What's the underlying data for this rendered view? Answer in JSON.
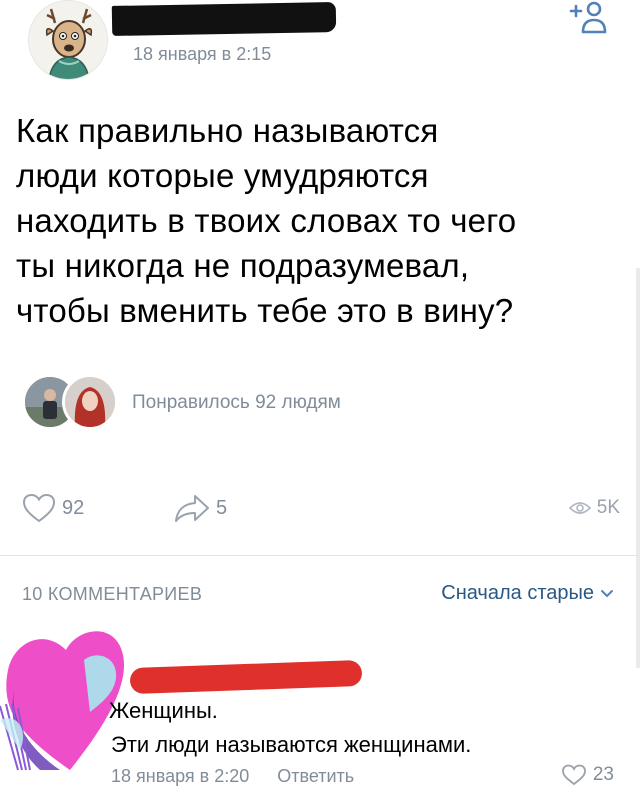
{
  "post": {
    "date": "18 января в 2:15",
    "text_lines": [
      "Как правильно называются",
      "люди которые умудряются",
      "находить в твоих словах то чего",
      "ты никогда не подразумевал,",
      "чтобы вменить тебе это в вину?"
    ],
    "likes_summary": "Понравилось 92 людям",
    "likes_count": "92",
    "shares_count": "5",
    "views_count": "5K"
  },
  "comments": {
    "count_label": "10 КОММЕНТАРИЕВ",
    "sort_label": "Сначала старые",
    "first": {
      "line1": "Женщины.",
      "line2": "Эти люди называются женщинами.",
      "date": "18 января в 2:20",
      "reply_label": "Ответить",
      "likes": "23"
    }
  },
  "colors": {
    "secondary_text": "#818c99",
    "link": "#2a5885",
    "redaction_black": "#111111",
    "redaction_red": "#e0302b"
  },
  "icons": {
    "add_friend": "add-friend-icon",
    "like": "heart-icon",
    "share": "share-arrow-icon",
    "views": "eye-icon",
    "sort": "chevron-down-icon"
  }
}
